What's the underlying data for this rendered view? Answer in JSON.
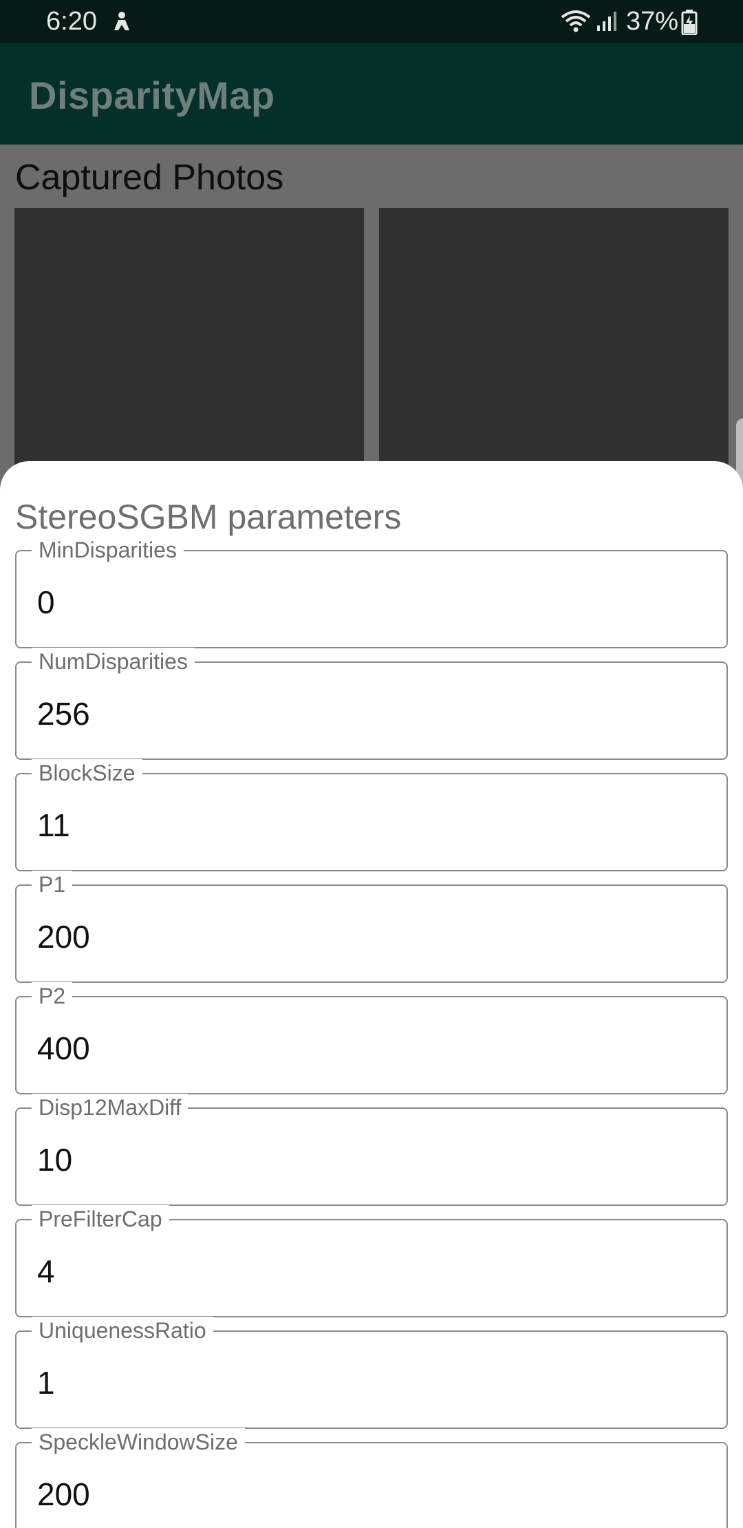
{
  "status_bar": {
    "time": "6:20",
    "battery": "37%",
    "icons": [
      "person-icon",
      "wifi-icon",
      "signal-icon",
      "battery-icon"
    ]
  },
  "app": {
    "title": "DisparityMap"
  },
  "main": {
    "section_title": "Captured Photos"
  },
  "sheet": {
    "title": "StereoSGBM parameters",
    "fields": [
      {
        "label": "MinDisparities",
        "value": "0"
      },
      {
        "label": "NumDisparities",
        "value": "256"
      },
      {
        "label": "BlockSize",
        "value": "11"
      },
      {
        "label": "P1",
        "value": "200"
      },
      {
        "label": "P2",
        "value": "400"
      },
      {
        "label": "Disp12MaxDiff",
        "value": "10"
      },
      {
        "label": "PreFilterCap",
        "value": "4"
      },
      {
        "label": "UniquenessRatio",
        "value": "1"
      },
      {
        "label": "SpeckleWindowSize",
        "value": "200"
      }
    ]
  },
  "colors": {
    "status_bar": "#061a16",
    "app_bar": "#03302a",
    "scrim": "#6c6c6c",
    "photo_placeholder": "#313131"
  }
}
